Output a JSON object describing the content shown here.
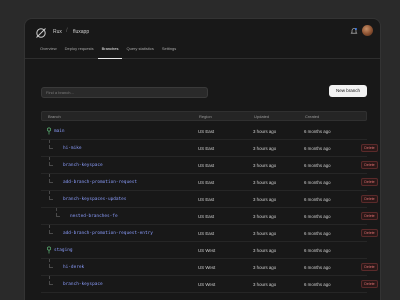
{
  "header": {
    "org": "Rux",
    "repo": "fluxapp"
  },
  "tabs": [
    {
      "label": "Overview",
      "active": false
    },
    {
      "label": "Deploy requests",
      "active": false
    },
    {
      "label": "Branches",
      "active": true
    },
    {
      "label": "Query statistics",
      "active": false
    },
    {
      "label": "Settings",
      "active": false
    }
  ],
  "search": {
    "placeholder": "Find a branch..."
  },
  "new_branch_label": "New branch",
  "table": {
    "headers": [
      "Branch",
      "Region",
      "Updated",
      "Created"
    ],
    "rows": [
      {
        "name": "main",
        "region": "US East",
        "updated": "3 hours ago",
        "created": "6 months ago",
        "depth": 0,
        "root": true,
        "delete": false
      },
      {
        "name": "hi-mike",
        "region": "US East",
        "updated": "3 hours ago",
        "created": "6 months ago",
        "depth": 1,
        "root": false,
        "delete": true
      },
      {
        "name": "branch-keyspace",
        "region": "US East",
        "updated": "3 hours ago",
        "created": "6 months ago",
        "depth": 1,
        "root": false,
        "delete": true
      },
      {
        "name": "add-branch-promotion-request",
        "region": "US East",
        "updated": "3 hours ago",
        "created": "6 months ago",
        "depth": 1,
        "root": false,
        "delete": true
      },
      {
        "name": "branch-keyspaces-updates",
        "region": "US East",
        "updated": "3 hours ago",
        "created": "6 months ago",
        "depth": 1,
        "root": false,
        "delete": true
      },
      {
        "name": "nested-branches-fe",
        "region": "US East",
        "updated": "3 hours ago",
        "created": "6 months ago",
        "depth": 2,
        "root": false,
        "delete": true
      },
      {
        "name": "add-branch-promotion-request-entry",
        "region": "US East",
        "updated": "3 hours ago",
        "created": "6 months ago",
        "depth": 1,
        "root": false,
        "delete": true
      },
      {
        "name": "staging",
        "region": "US West",
        "updated": "3 hours ago",
        "created": "6 months ago",
        "depth": 0,
        "root": true,
        "delete": false
      },
      {
        "name": "hi-derek",
        "region": "US West",
        "updated": "3 hours ago",
        "created": "6 months ago",
        "depth": 1,
        "root": false,
        "delete": true
      },
      {
        "name": "branch-keyspace",
        "region": "US West",
        "updated": "3 hours ago",
        "created": "6 months ago",
        "depth": 1,
        "root": false,
        "delete": true
      }
    ]
  },
  "delete_label": "Delete",
  "icons": {
    "logo": "slashed-circle-logo-icon",
    "notifications": "bell-icon",
    "branch": "branch-icon"
  },
  "colors": {
    "branch_name": "#8c9eff",
    "delete": "#e07070",
    "background": "#181818"
  }
}
